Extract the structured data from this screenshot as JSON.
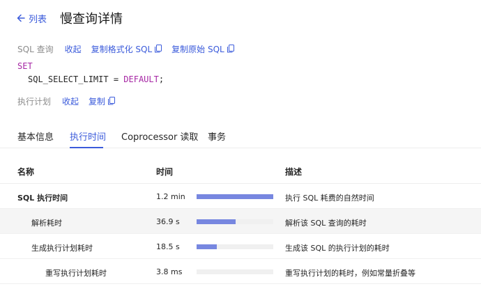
{
  "header": {
    "back_label": "列表",
    "title": "慢查询详情"
  },
  "sql_query": {
    "label": "SQL 查询",
    "collapse": "收起",
    "copy_formatted": "复制格式化 SQL",
    "copy_original": "复制原始 SQL",
    "code_keyword_set": "SET",
    "code_line2_text": "SQL_SELECT_LIMIT = ",
    "code_line2_keyword": "DEFAULT",
    "code_line2_end": ";"
  },
  "plan": {
    "label": "执行计划",
    "collapse": "收起",
    "copy": "复制"
  },
  "tabs": [
    {
      "label": "基本信息"
    },
    {
      "label": "执行时间"
    },
    {
      "label": "Coprocessor 读取"
    },
    {
      "label": "事务"
    }
  ],
  "active_tab": "执行时间",
  "table": {
    "headers": {
      "name": "名称",
      "time": "时间",
      "desc": "描述"
    },
    "rows": [
      {
        "name": "SQL 执行时间",
        "time": "1.2 min",
        "fraction": 1.0,
        "desc": "执行 SQL 耗费的自然时间"
      },
      {
        "name": "解析耗时",
        "time": "36.9 s",
        "fraction": 0.51,
        "desc": "解析该 SQL 查询的耗时"
      },
      {
        "name": "生成执行计划耗时",
        "time": "18.5 s",
        "fraction": 0.26,
        "desc": "生成该 SQL 的执行计划的耗时"
      },
      {
        "name": "重写执行计划耗时",
        "time": "3.8 ms",
        "fraction": 0.0,
        "desc": "重写执行计划的耗时，例如常量折叠等"
      }
    ]
  },
  "colors": {
    "accent": "#3b5bdb",
    "bar": "#7787e0",
    "keyword": "#a626a4"
  }
}
